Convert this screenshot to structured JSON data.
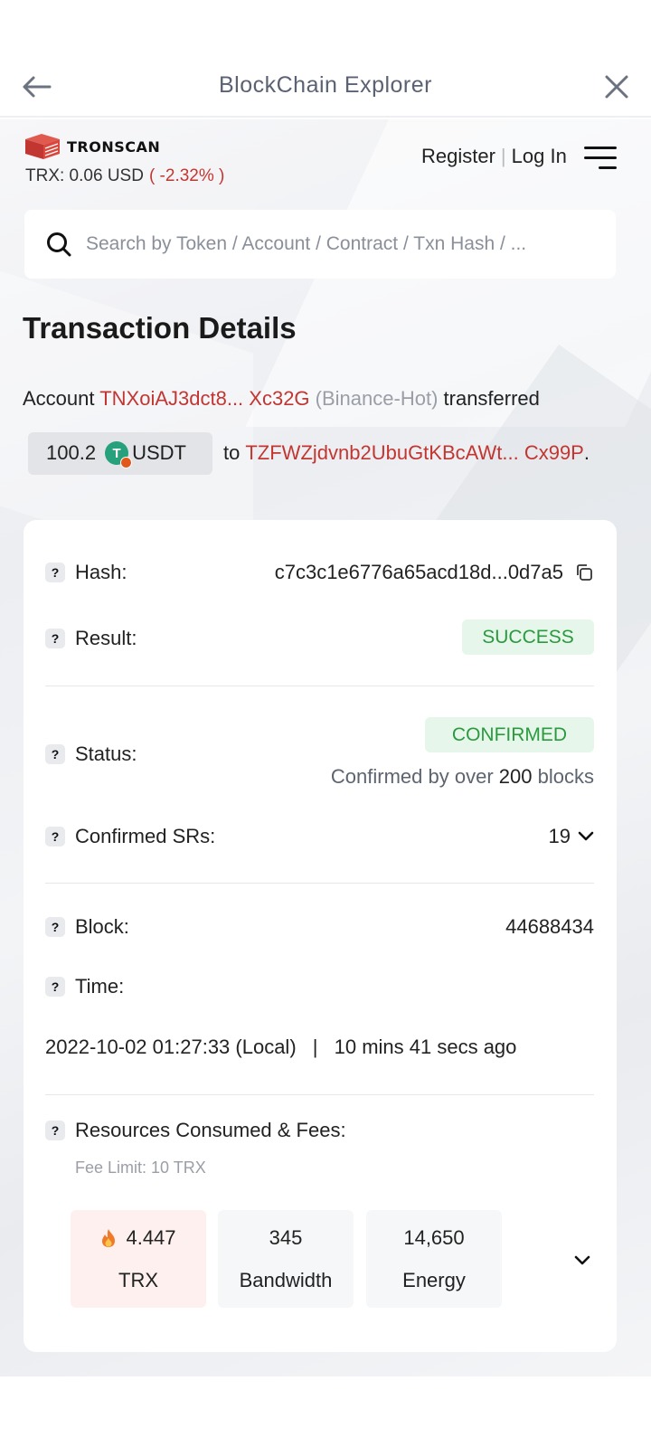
{
  "topbar": {
    "title": "BlockChain Explorer"
  },
  "brand": {
    "logo_text": "TRONSCAN"
  },
  "price": {
    "text": "TRX: 0.06 USD",
    "change": "( -2.32% )"
  },
  "auth": {
    "register": "Register",
    "separator": "|",
    "login": "Log In"
  },
  "search": {
    "placeholder": "Search by Token / Account / Contract / Txn Hash / ..."
  },
  "page": {
    "title": "Transaction Details"
  },
  "summary": {
    "account_word": "Account",
    "from_address": "TNXoiAJ3dct8... Xc32G",
    "from_tag": "(Binance-Hot)",
    "verb": "transferred",
    "amount": "100.2",
    "token": "USDT",
    "to_word": "to",
    "to_address": "TZFWZjdvnb2UbuGtKBcAWt... Cx99P",
    "period": "."
  },
  "details": {
    "hash_label": "Hash:",
    "hash_value": "c7c3c1e6776a65acd18d...0d7a5",
    "result_label": "Result:",
    "result_value": "SUCCESS",
    "status_label": "Status:",
    "status_value": "CONFIRMED",
    "confirm_prefix": "Confirmed by over",
    "confirm_count": "200",
    "confirm_suffix": "blocks",
    "srs_label": "Confirmed SRs:",
    "srs_value": "19",
    "block_label": "Block:",
    "block_value": "44688434",
    "time_label": "Time:",
    "time_local": "2022-10-02 01:27:33 (Local)",
    "time_sep": "|",
    "time_ago": "10 mins 41 secs ago",
    "resources_label": "Resources Consumed & Fees:",
    "fee_limit": "Fee Limit: 10 TRX"
  },
  "fees": [
    {
      "value": "4.447",
      "unit": "TRX",
      "icon": "fire-icon"
    },
    {
      "value": "345",
      "unit": "Bandwidth"
    },
    {
      "value": "14,650",
      "unit": "Energy"
    }
  ],
  "colors": {
    "accent_red": "#c23631",
    "success_green": "#2b9a3f",
    "success_bg": "#e6f6ea"
  }
}
